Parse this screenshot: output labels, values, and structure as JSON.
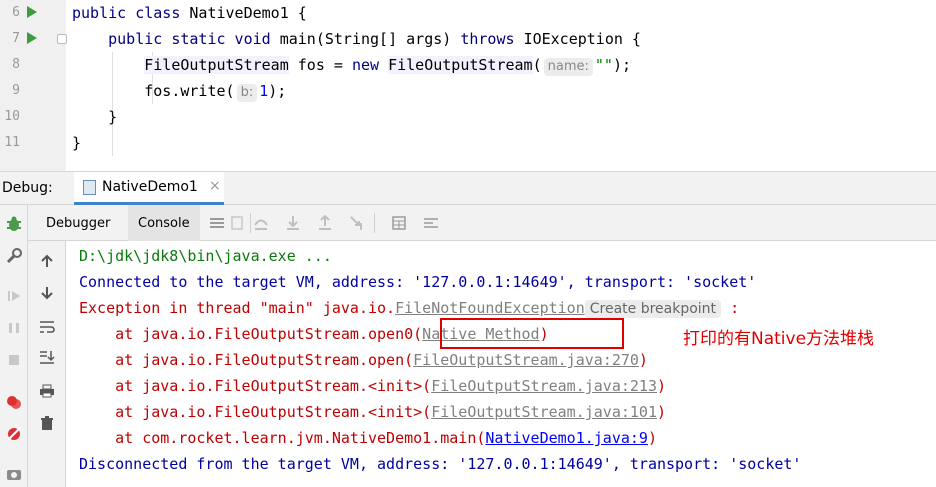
{
  "editor": {
    "lines": [
      {
        "num": "6",
        "tokens": [
          [
            "kw",
            "public class "
          ],
          [
            "",
            "NativeDemo1 {"
          ]
        ]
      },
      {
        "num": "7",
        "tokens": [
          [
            "",
            "    "
          ],
          [
            "kw",
            "public static void "
          ],
          [
            "",
            "main(String[] args) "
          ],
          [
            "kw",
            "throws "
          ],
          [
            "",
            "IOException {"
          ]
        ]
      },
      {
        "num": "8",
        "tokens": [
          [
            "",
            "        "
          ],
          [
            "cls-hl",
            "FileOutputStream"
          ],
          [
            "",
            " fos = "
          ],
          [
            "kw",
            "new "
          ],
          [
            "cls-hl",
            "FileOutputStream"
          ],
          [
            "",
            "("
          ],
          [
            "hint",
            "name:"
          ],
          [
            "str",
            "\"\""
          ],
          [
            "",
            ");"
          ]
        ]
      },
      {
        "num": "9",
        "tokens": [
          [
            "",
            "        fos.write("
          ],
          [
            "hint",
            "b:"
          ],
          [
            "num",
            "1"
          ],
          [
            "",
            ");"
          ]
        ]
      },
      {
        "num": "10",
        "tokens": [
          [
            "",
            "    }"
          ]
        ]
      },
      {
        "num": "11",
        "tokens": [
          [
            "",
            "}"
          ]
        ]
      }
    ]
  },
  "debug": {
    "label": "Debug:",
    "tab_label": "NativeDemo1",
    "tab_close": "×",
    "subtabs": [
      "Debugger",
      "Console"
    ]
  },
  "console": {
    "lines": [
      [
        [
          "green",
          "D:\\jdk\\jdk8\\bin\\java.exe ..."
        ]
      ],
      [
        [
          "blue",
          "Connected to the target VM, address: '127.0.0.1:14649', transport: 'socket'"
        ]
      ],
      [
        [
          "red",
          "Exception in thread \"main\" java.io."
        ],
        [
          "link",
          "FileNotFoundException"
        ],
        [
          "bp",
          "Create breakpoint"
        ],
        [
          "red",
          " :"
        ]
      ],
      [
        [
          "red",
          "    at java.io.FileOutputStream.open0("
        ],
        [
          "link",
          "Native Method"
        ],
        [
          "red",
          ")"
        ]
      ],
      [
        [
          "red",
          "    at java.io.FileOutputStream.open("
        ],
        [
          "link",
          "FileOutputStream.java:270"
        ],
        [
          "red",
          ")"
        ]
      ],
      [
        [
          "red",
          "    at java.io.FileOutputStream.<init>("
        ],
        [
          "link",
          "FileOutputStream.java:213"
        ],
        [
          "red",
          ")"
        ]
      ],
      [
        [
          "red",
          "    at java.io.FileOutputStream.<init>("
        ],
        [
          "link",
          "FileOutputStream.java:101"
        ],
        [
          "red",
          ")"
        ]
      ],
      [
        [
          "red",
          "    at com.rocket.learn.jvm.NativeDemo1.main("
        ],
        [
          "link-blue",
          "NativeDemo1.java:9"
        ],
        [
          "red",
          ")"
        ]
      ],
      [
        [
          "blue",
          "Disconnected from the target VM, address: '127.0.0.1:14649', transport: 'socket'"
        ]
      ]
    ],
    "annotation": "打印的有Native方法堆栈"
  },
  "icons": {
    "left_tools": [
      "bug-icon",
      "wrench-icon",
      "resume-icon",
      "pause-icon",
      "stop-icon",
      "view-breakpoints-icon",
      "mute-breakpoints-icon",
      "camera-icon"
    ],
    "sub_toolbar": [
      "menu-icon",
      "restore-layout-icon",
      "step-over-icon",
      "step-into-icon",
      "step-out-icon",
      "run-to-cursor-icon",
      "evaluate-icon",
      "trace-icon"
    ],
    "console_tools": [
      "arrow-up-icon",
      "arrow-down-icon",
      "soft-wrap-icon",
      "scroll-to-end-icon",
      "print-icon",
      "trash-icon"
    ]
  }
}
